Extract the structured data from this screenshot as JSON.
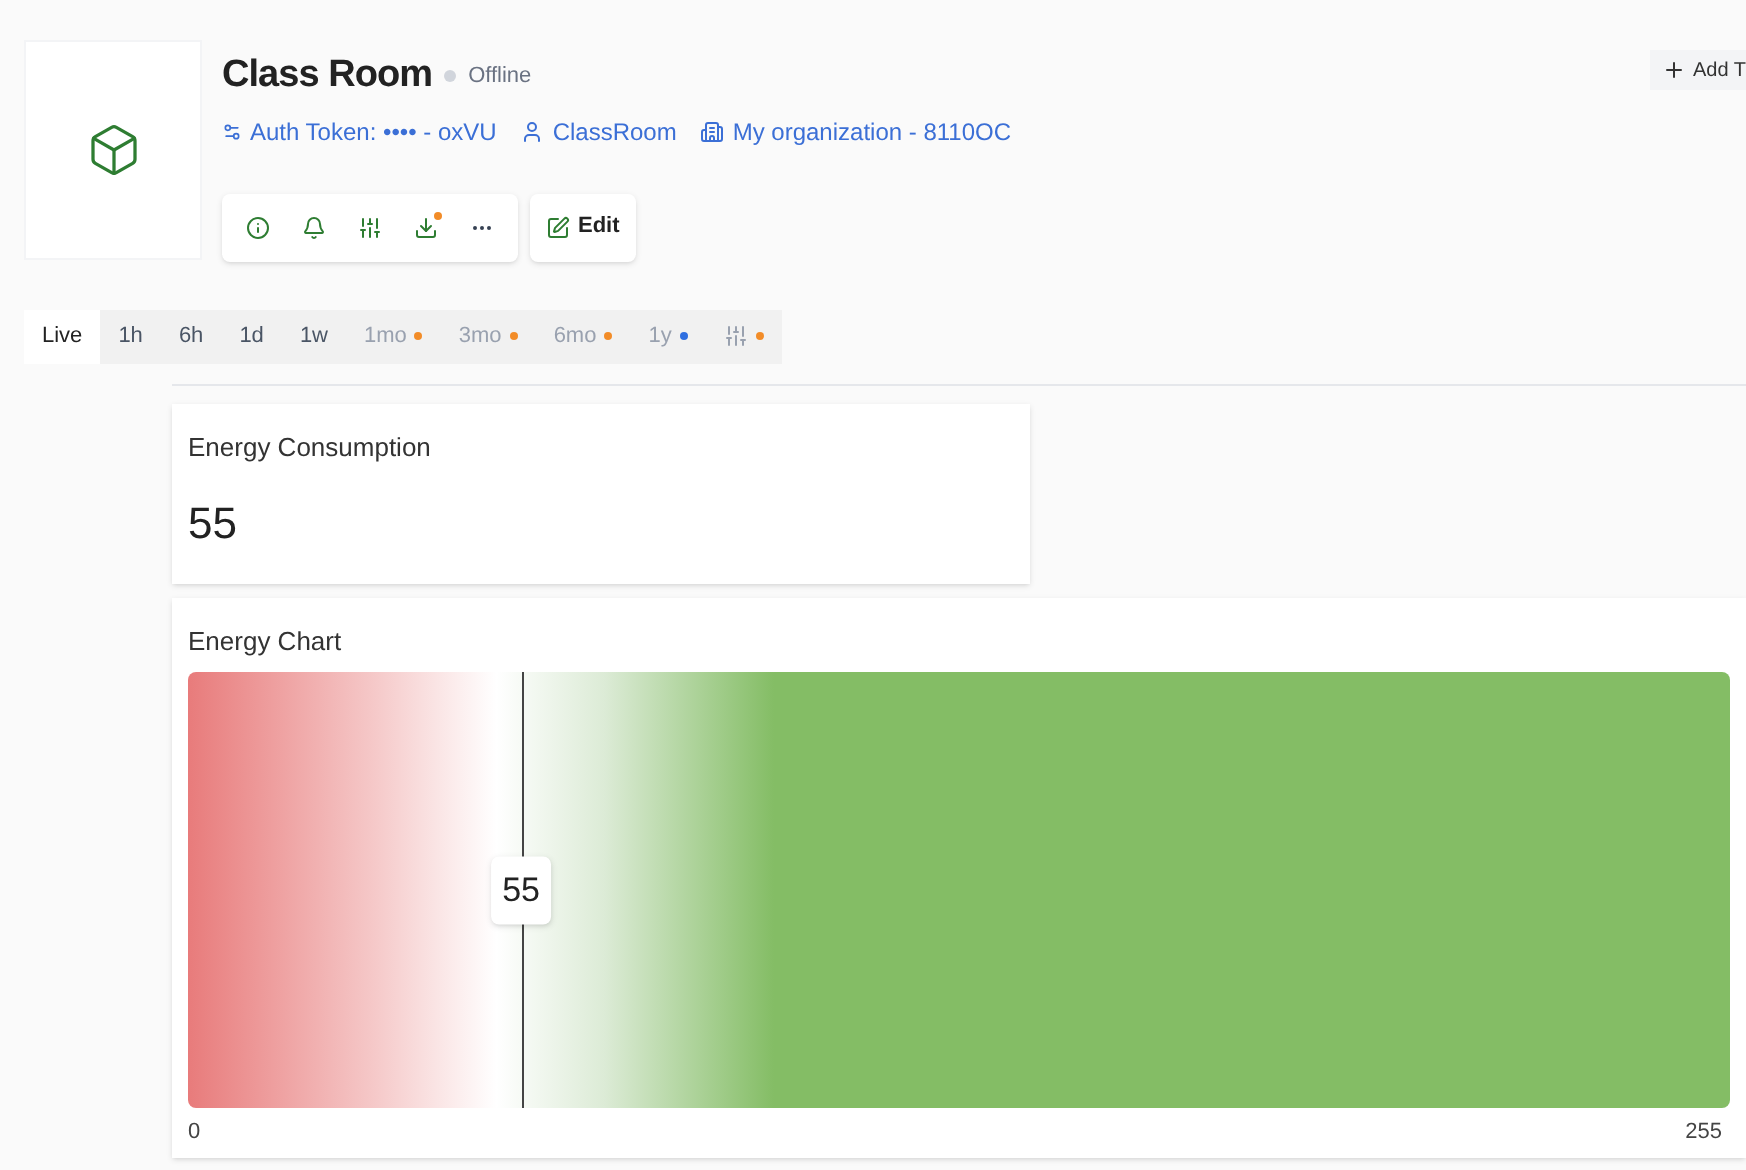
{
  "device": {
    "title": "Class Room",
    "status": "Offline",
    "online": false,
    "auth_token": "Auth Token: •••• - oxVU",
    "customer": "ClassRoom",
    "organization": "My organization - 8110OC"
  },
  "edit_button": "Edit",
  "add_button": "Add T",
  "time_tabs": [
    {
      "label": "Live",
      "selected": true
    },
    {
      "label": "1h",
      "selected": false
    },
    {
      "label": "6h",
      "selected": false
    },
    {
      "label": "1d",
      "selected": false
    },
    {
      "label": "1w",
      "selected": false
    },
    {
      "label": "1mo",
      "selected": false,
      "color": "#f28c28"
    },
    {
      "label": "3mo",
      "selected": false,
      "color": "#f28c28"
    },
    {
      "label": "6mo",
      "selected": false,
      "color": "#f28c28"
    },
    {
      "label": "1y",
      "selected": false,
      "color": "#2f6fe0"
    },
    {
      "kind": "filter",
      "selected": false,
      "color": "#f28c28"
    }
  ],
  "value_widget": {
    "title": "Energy Consumption",
    "value": "55"
  },
  "gauge_widget": {
    "title": "Energy Chart",
    "value": "55",
    "level": 0.216,
    "min": "0",
    "max": "255"
  }
}
